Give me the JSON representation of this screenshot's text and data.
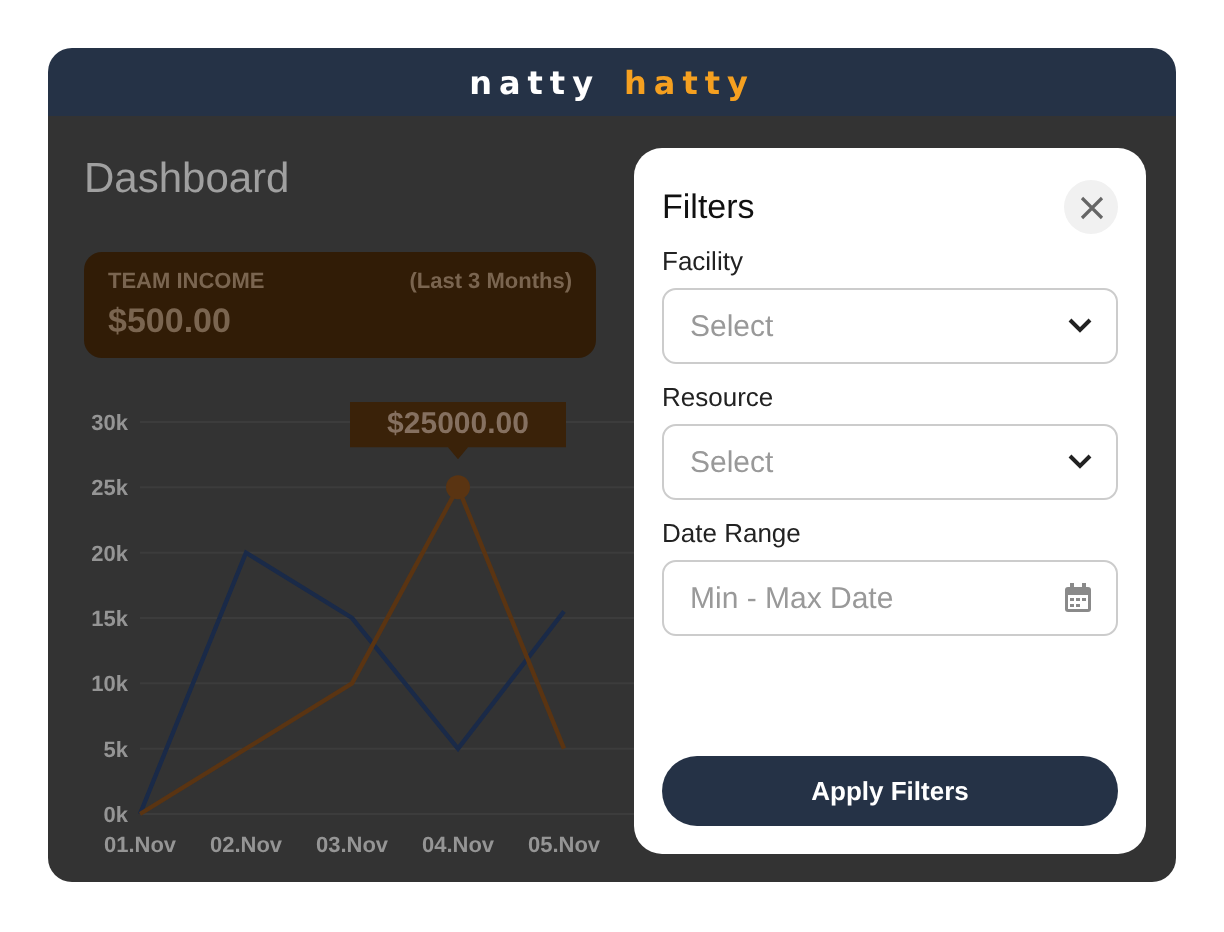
{
  "header": {
    "logo": [
      {
        "text": "natty",
        "kind": "plain"
      },
      {
        "text": "hatty",
        "kind": "accent"
      }
    ]
  },
  "dashboard": {
    "title": "Dashboard",
    "stat_card": {
      "label": "TEAM INCOME",
      "period": "(Last 3 Months)",
      "value": "$500.00"
    },
    "chart_data": {
      "type": "line",
      "categories": [
        "01.Nov",
        "02.Nov",
        "03.Nov",
        "04.Nov",
        "05.Nov"
      ],
      "series": [
        {
          "color": "#1a2a48",
          "values": [
            0,
            20000,
            15000,
            5000,
            15500
          ]
        },
        {
          "color": "#5a3412",
          "values": [
            0,
            5000,
            10000,
            25000,
            5000
          ]
        }
      ],
      "ylim": [
        0,
        30000
      ],
      "grid": true,
      "yticks": [
        {
          "value": 0,
          "label": "0k"
        },
        {
          "value": 5000,
          "label": "5k"
        },
        {
          "value": 10000,
          "label": "10k"
        },
        {
          "value": 15000,
          "label": "15k"
        },
        {
          "value": 20000,
          "label": "20k"
        },
        {
          "value": 25000,
          "label": "25k"
        },
        {
          "value": 30000,
          "label": "30k"
        }
      ],
      "annotations": [
        {
          "x": "04.Nov",
          "y": 25000,
          "text": "$25000.00"
        }
      ]
    }
  },
  "filters": {
    "title": "Filters",
    "fields": [
      {
        "label": "Facility",
        "placeholder": "Select",
        "kind": "select"
      },
      {
        "label": "Resource",
        "placeholder": "Select",
        "kind": "select"
      },
      {
        "label": "Date Range",
        "placeholder": "Min - Max Date",
        "kind": "date"
      }
    ],
    "apply_button": "Apply Filters"
  }
}
